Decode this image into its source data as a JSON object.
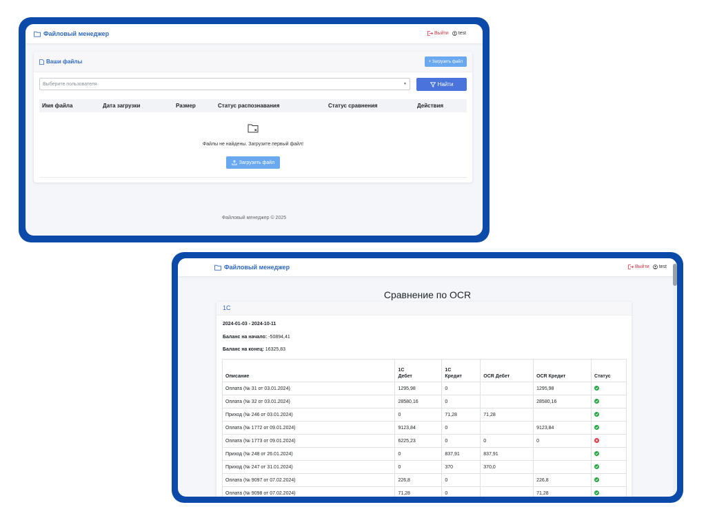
{
  "window1": {
    "navbar": {
      "brand": "Файловый менеджер",
      "logout": "Выйти",
      "user": "test"
    },
    "card": {
      "title": "Ваши файлы",
      "upload_small_label": "+ Загрузить файл",
      "select_placeholder": "Выберите пользователя",
      "find_label": "Найти",
      "columns": [
        "Имя файла",
        "Дата загрузки",
        "Размер",
        "Статус распознавания",
        "Статус сравнения",
        "Действия"
      ],
      "empty_text": "Файлы не найдены. Загрузите первый файл!",
      "upload_big_label": "Загрузить файл"
    },
    "footer": "Файловый менеджер © 2025"
  },
  "window2": {
    "navbar": {
      "brand": "Файловый менеджер",
      "logout": "Выйти",
      "user": "test"
    },
    "page_title": "Сравнение по OCR",
    "card": {
      "title": "1С",
      "period": "2024-01-03 - 2024-10-11",
      "balance_start_label": "Баланс на начало:",
      "balance_start_value": "-50894,41",
      "balance_end_label": "Баланс на конец:",
      "balance_end_value": "16325,83",
      "columns": [
        "Описание",
        "1С\nДебет",
        "1С\nКредит",
        "OCR Дебет",
        "OCR Кредит",
        "Статус"
      ],
      "rows": [
        {
          "desc": "Оплата (№ 31 от 03.01.2024)",
          "debit": "1295,98",
          "credit": "0",
          "ocr_debit": "",
          "ocr_credit": "1295,98",
          "ok": true
        },
        {
          "desc": "Оплата (№ 32 от 03.01.2024)",
          "debit": "28580,16",
          "credit": "0",
          "ocr_debit": "",
          "ocr_credit": "28580,16",
          "ok": true
        },
        {
          "desc": "Приход (№ 246 от 03.01.2024)",
          "debit": "0",
          "credit": "71,28",
          "ocr_debit": "71,28",
          "ocr_credit": "",
          "ok": true
        },
        {
          "desc": "Оплата (№ 1772 от 09.01.2024)",
          "debit": "9123,84",
          "credit": "0",
          "ocr_debit": "",
          "ocr_credit": "9123,84",
          "ok": true
        },
        {
          "desc": "Оплата (№ 1773 от 09.01.2024)",
          "debit": "6225,23",
          "credit": "0",
          "ocr_debit": "0",
          "ocr_credit": "0",
          "ok": false
        },
        {
          "desc": "Приход (№ 248 от 26.01.2024)",
          "debit": "0",
          "credit": "837,91",
          "ocr_debit": "837,91",
          "ocr_credit": "",
          "ok": true
        },
        {
          "desc": "Приход (№ 247 от 31.01.2024)",
          "debit": "0",
          "credit": "370",
          "ocr_debit": "370,0",
          "ocr_credit": "",
          "ok": true
        },
        {
          "desc": "Оплата (№ 9097 от 07.02.2024)",
          "debit": "226,8",
          "credit": "0",
          "ocr_debit": "",
          "ocr_credit": "226,8",
          "ok": true
        },
        {
          "desc": "Оплата (№ 9098 от 07.02.2024)",
          "debit": "71,28",
          "credit": "0",
          "ocr_debit": "",
          "ocr_credit": "71,28",
          "ok": true
        }
      ]
    }
  },
  "colors": {
    "frame": "#0b4aa8",
    "brand": "#2f68c8",
    "danger": "#dc3545",
    "success": "#28a745",
    "primary": "#4a74db",
    "info": "#6aa8ef"
  }
}
